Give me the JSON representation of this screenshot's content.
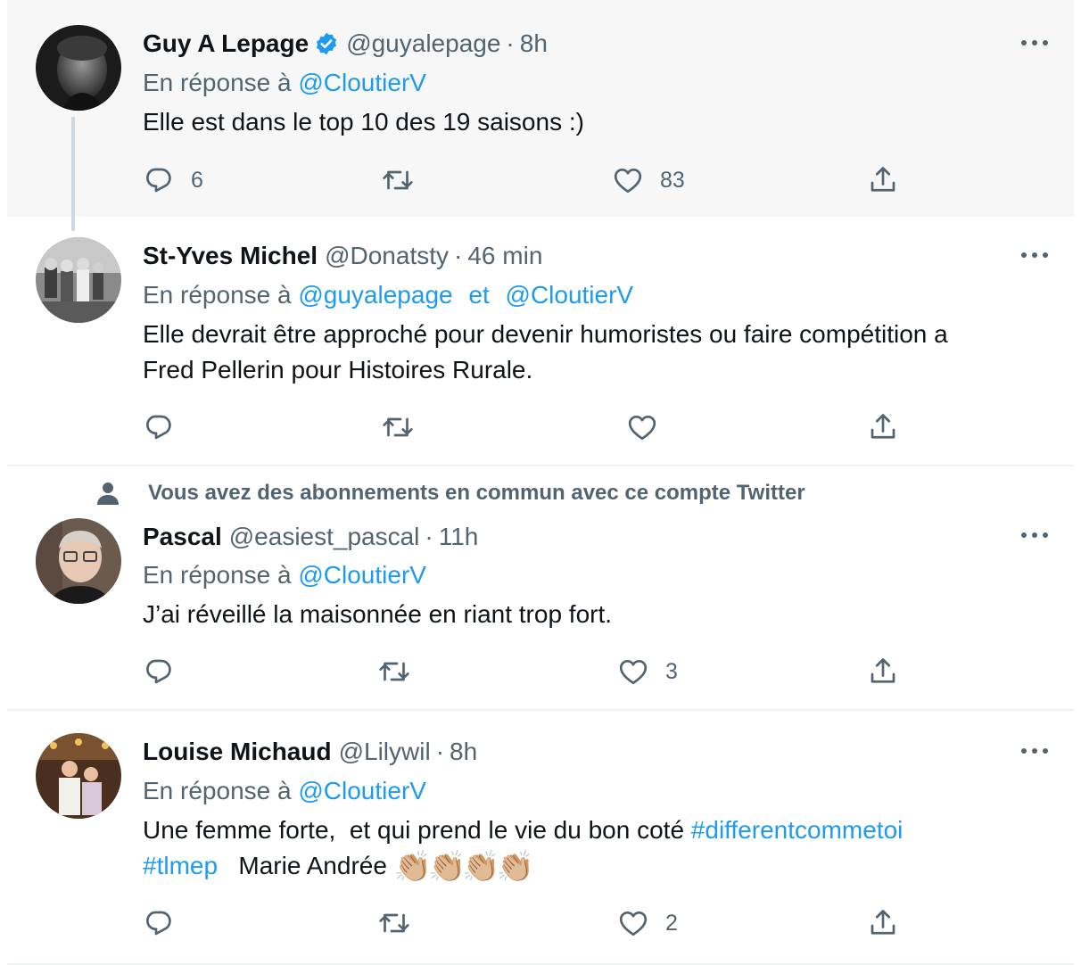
{
  "reply_prefix": "En réponse à",
  "and_word": "et",
  "tweets": [
    {
      "name": "Guy A Lepage",
      "handle": "@guyalepage",
      "sep": "·",
      "time": "8h",
      "reply_to": [
        "@CloutierV"
      ],
      "text": "Elle est dans le top 10 des 19 saisons :)",
      "replies": "6",
      "retweets": "",
      "likes": "83"
    },
    {
      "name": "St-Yves Michel",
      "handle": "@Donatsty",
      "sep": "·",
      "time": "46 min",
      "reply_to": [
        "@guyalepage",
        "@CloutierV"
      ],
      "text_line1": "Elle devrait être approché pour devenir humoristes ou faire compétition a",
      "text_line2": "Fred Pellerin pour Histoires Rurale.",
      "replies": "",
      "retweets": "",
      "likes": ""
    },
    {
      "social_context": "Vous avez des abonnements en commun avec ce compte Twitter",
      "name": "Pascal",
      "handle": "@easiest_pascal",
      "sep": "·",
      "time": "11h",
      "reply_to": [
        "@CloutierV"
      ],
      "text": "J’ai réveillé la maisonnée en riant trop fort.",
      "replies": "",
      "retweets": "",
      "likes": "3"
    },
    {
      "name": "Louise Michaud",
      "handle": "@Lilywil",
      "sep": "·",
      "time": "8h",
      "reply_to": [
        "@CloutierV"
      ],
      "text_part1": "Une femme forte,  et qui prend le vie du bon coté ",
      "hashtag1": "#differentcommetoi",
      "hashtag2": "#tlmep",
      "text_part2": "   Marie Andrée ",
      "emoji": "👏🏼👏🏼👏🏼👏🏼",
      "replies": "",
      "retweets": "",
      "likes": "2"
    }
  ],
  "colors": {
    "accent": "#1d9bf0",
    "secondary_text": "#536471",
    "primary_text": "#0f1419",
    "highlight_bg": "#f7f7f7",
    "divider": "#eff3f4"
  },
  "icons": [
    "verified-badge-icon",
    "more-icon",
    "reply-icon",
    "retweet-icon",
    "like-icon",
    "share-icon",
    "person-icon"
  ]
}
